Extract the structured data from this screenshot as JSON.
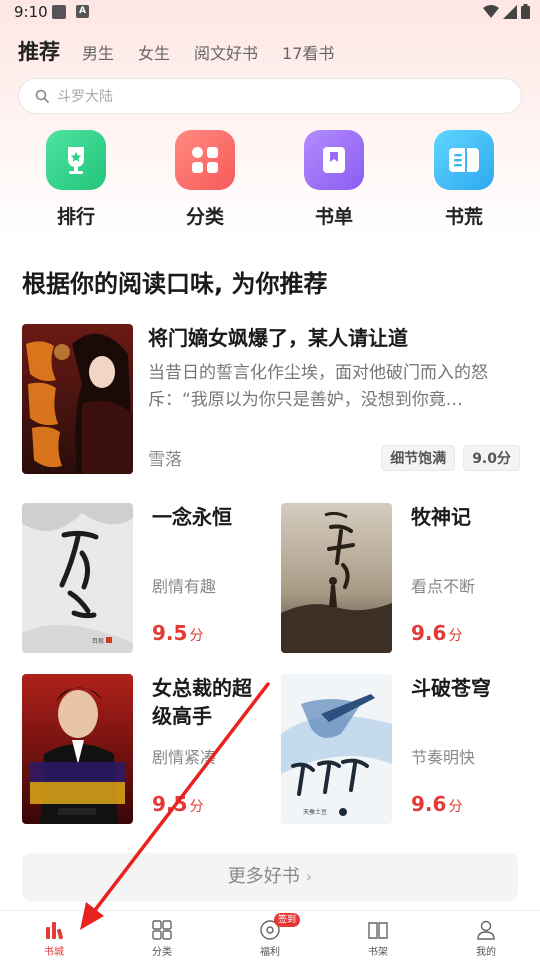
{
  "status_bar": {
    "time": "9:10"
  },
  "tabs": [
    {
      "label": "推荐",
      "active": true
    },
    {
      "label": "男生"
    },
    {
      "label": "女生"
    },
    {
      "label": "阅文好书"
    },
    {
      "label": "17看书"
    }
  ],
  "search": {
    "placeholder": "斗罗大陆"
  },
  "categories": [
    {
      "label": "排行",
      "icon": "trophy-icon",
      "color": "#3dd68c"
    },
    {
      "label": "分类",
      "icon": "grid-icon",
      "color": "#ff6b6b"
    },
    {
      "label": "书单",
      "icon": "booklist-icon",
      "color": "#9b6cf6"
    },
    {
      "label": "书荒",
      "icon": "book-open-icon",
      "color": "#3cbcf0"
    }
  ],
  "section": {
    "title": "根据你的阅读口味, 为你推荐"
  },
  "featured": {
    "title": "将门嫡女飒爆了，某人请让道",
    "description": "当昔日的誓言化作尘埃，面对他破门而入的怒斥：“我原以为你只是善妒，没想到你竟…",
    "author": "雪落",
    "tags": [
      "细节饱满",
      "9.0分"
    ]
  },
  "books": [
    {
      "title": "一念永恒",
      "tagline": "剧情有趣",
      "score": "9.5",
      "unit": "分"
    },
    {
      "title": "牧神记",
      "tagline": "看点不断",
      "score": "9.6",
      "unit": "分"
    },
    {
      "title": "女总裁的超级高手",
      "tagline": "剧情紧凑",
      "score": "9.5",
      "unit": "分"
    },
    {
      "title": "斗破苍穹",
      "tagline": "节奏明快",
      "score": "9.6",
      "unit": "分"
    }
  ],
  "more_button": {
    "label": "更多好书"
  },
  "bottom_nav": [
    {
      "label": "书城",
      "active": true
    },
    {
      "label": "分类"
    },
    {
      "label": "福利",
      "badge": "签到"
    },
    {
      "label": "书架"
    },
    {
      "label": "我的"
    }
  ],
  "colors": {
    "accent": "#e53935",
    "annotation": "#e8231f"
  }
}
